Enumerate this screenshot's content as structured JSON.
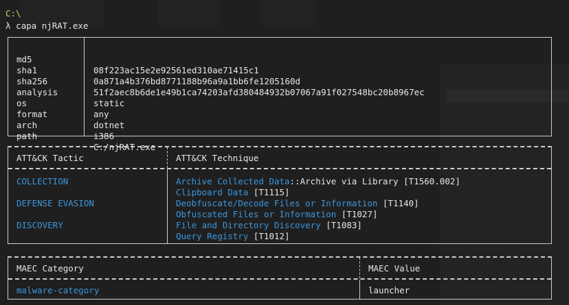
{
  "terminal": {
    "prompt_path": "C:\\",
    "prompt_symbol": "λ",
    "command": "capa njRAT.exe"
  },
  "metadata": [
    {
      "key": "md5",
      "value": "08f223ac15e2e92561ed310ae71415c1"
    },
    {
      "key": "sha1",
      "value": "0a871a4b376bd8771188b96a9a1bb6fe1205160d"
    },
    {
      "key": "sha256",
      "value": "51f2aec8b6de1e49b1ca74203afd380484932b07067a91f027548bc20b8967ec"
    },
    {
      "key": "analysis",
      "value": "static"
    },
    {
      "key": "os",
      "value": "any"
    },
    {
      "key": "format",
      "value": "dotnet"
    },
    {
      "key": "arch",
      "value": "i386"
    },
    {
      "key": "path",
      "value": "C:/njRAT.exe"
    }
  ],
  "attack": {
    "header_tactic": "ATT&CK Tactic",
    "header_technique": "ATT&CK Technique",
    "tactics": [
      "COLLECTION",
      "DEFENSE EVASION",
      "DISCOVERY"
    ],
    "techniques": [
      {
        "name": "Archive Collected Data",
        "rest": "::Archive via Library [T1560.002]"
      },
      {
        "name": "Clipboard Data",
        "rest": " [T1115]"
      },
      {
        "name": "Deobfuscate/Decode Files or Information",
        "rest": " [T1140]"
      },
      {
        "name": "Obfuscated Files or Information",
        "rest": " [T1027]"
      },
      {
        "name": "File and Directory Discovery",
        "rest": " [T1083]"
      },
      {
        "name": "Query Registry",
        "rest": " [T1012]"
      }
    ]
  },
  "maec": {
    "header_category": "MAEC Category",
    "header_value": "MAEC Value",
    "category": "malware-category",
    "value": "launcher"
  },
  "colors": {
    "background": "#1f1f1f",
    "text": "#e6e6e6",
    "link_blue": "#3a96dd",
    "prompt_green": "#b5e34a",
    "border": "#cfcfcf"
  }
}
